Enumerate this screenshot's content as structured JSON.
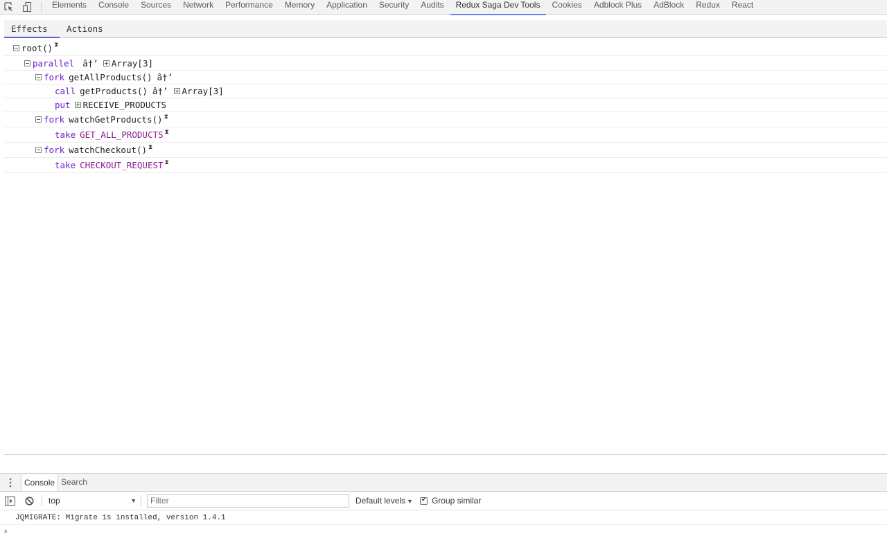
{
  "devtools": {
    "tabs": [
      {
        "label": "Elements"
      },
      {
        "label": "Console"
      },
      {
        "label": "Sources"
      },
      {
        "label": "Network"
      },
      {
        "label": "Performance"
      },
      {
        "label": "Memory"
      },
      {
        "label": "Application"
      },
      {
        "label": "Security"
      },
      {
        "label": "Audits"
      },
      {
        "label": "Redux Saga Dev Tools",
        "active": true
      },
      {
        "label": "Cookies"
      },
      {
        "label": "Adblock Plus"
      },
      {
        "label": "AdBlock"
      },
      {
        "label": "Redux"
      },
      {
        "label": "React"
      }
    ],
    "accent_color": "#6b7de8"
  },
  "saga": {
    "tabs": [
      {
        "label": "Effects",
        "active": true
      },
      {
        "label": "Actions"
      }
    ],
    "tree": {
      "root": {
        "label": "root()",
        "pending": true
      },
      "parallel": {
        "keyword": "parallel",
        "arrow": "â†’",
        "result": "Array[3]"
      },
      "fork1": {
        "keyword": "fork",
        "name": "getAllProducts()",
        "arrow": "â†’"
      },
      "call1": {
        "keyword": "call",
        "name": "getProducts()",
        "arrow": "â†’",
        "result": "Array[3]"
      },
      "put1": {
        "keyword": "put",
        "action": "RECEIVE_PRODUCTS"
      },
      "fork2": {
        "keyword": "fork",
        "name": "watchGetProducts()",
        "pending": true
      },
      "take1": {
        "keyword": "take",
        "pattern": "GET_ALL_PRODUCTS",
        "pending": true
      },
      "fork3": {
        "keyword": "fork",
        "name": "watchCheckout()",
        "pending": true
      },
      "take2": {
        "keyword": "take",
        "pattern": "CHECKOUT_REQUEST",
        "pending": true
      }
    },
    "colors": {
      "keyword": "#6a1fc8",
      "action": "#8a1a8f"
    }
  },
  "drawer": {
    "tabs": [
      {
        "label": "Console",
        "active": true
      },
      {
        "label": "Search"
      }
    ],
    "toolbar": {
      "context": "top",
      "filter_placeholder": "Filter",
      "levels": "Default levels",
      "group_similar_label": "Group similar",
      "group_similar_checked": true
    },
    "messages": [
      {
        "text": "JQMIGRATE: Migrate is installed, version 1.4.1"
      }
    ],
    "prompt": "›"
  }
}
